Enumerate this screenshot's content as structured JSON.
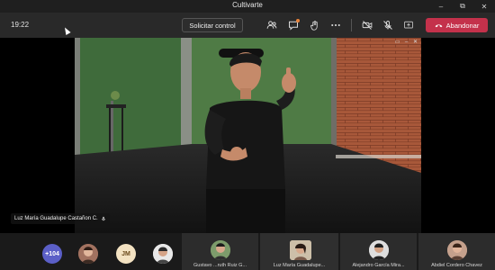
{
  "window": {
    "title": "Cultivarte"
  },
  "toolbar": {
    "time": "19:22",
    "request_control_label": "Solicitar control",
    "leave_label": "Abandonar",
    "leave_color": "#c4314b",
    "notification_color": "#e9833b",
    "icons": [
      "participants-icon",
      "chat-icon",
      "raise-hand-icon",
      "more-options-icon",
      "camera-off-icon",
      "mic-off-icon",
      "share-screen-icon",
      "hang-up-icon"
    ]
  },
  "main_video": {
    "speaker_name": "Luz María Guadalupe Castañon C."
  },
  "participants": {
    "overflow_count": "+104",
    "initials": "JM",
    "tiles": [
      {
        "name": "Gustavo ...ruth Ruiz G..."
      },
      {
        "name": "Luz María Guadalupe..."
      },
      {
        "name": "Alejandro García Mira..."
      },
      {
        "name": "Abdiel Cordero Chavez"
      }
    ]
  }
}
